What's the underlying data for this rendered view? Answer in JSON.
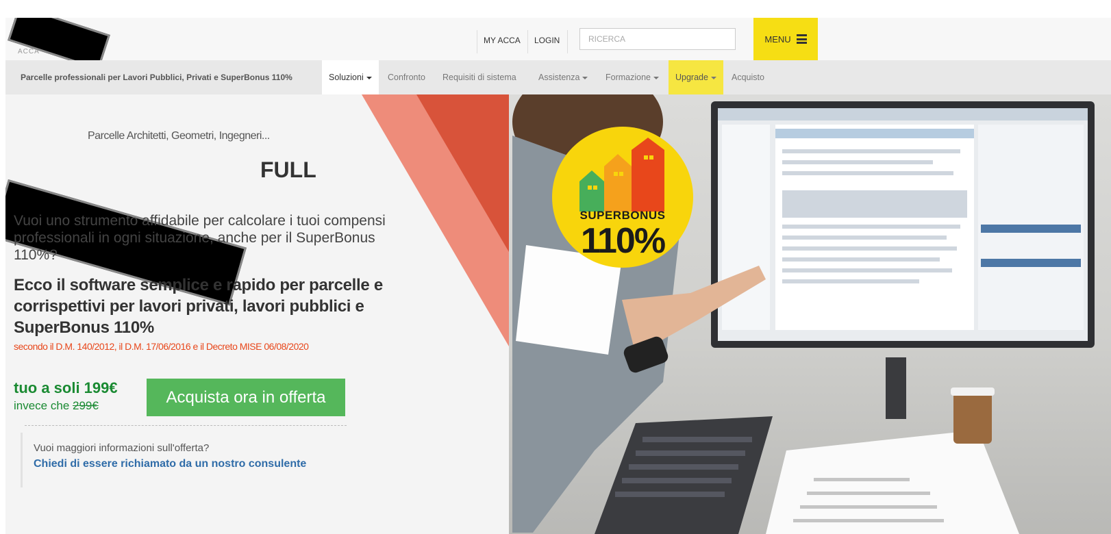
{
  "header": {
    "logo_text": "ACCA",
    "links": [
      "MY ACCA",
      "LOGIN"
    ],
    "search_placeholder": "RICERCA",
    "menu_label": "MENU"
  },
  "nav": {
    "brand": "Parcelle professionali per Lavori Pubblici, Privati e SuperBonus 110%",
    "items": [
      {
        "label": "Soluzioni",
        "dropdown": true
      },
      {
        "label": "Confronto",
        "dropdown": false
      },
      {
        "label": "Requisiti di sistema",
        "dropdown": false
      },
      {
        "label": "Assistenza",
        "dropdown": true
      },
      {
        "label": "Formazione",
        "dropdown": true
      },
      {
        "label": "Upgrade",
        "dropdown": true
      },
      {
        "label": "Acquisto",
        "dropdown": false
      }
    ]
  },
  "hero": {
    "subtitle_partial": "Parcelle Architetti, Geometri, Ingegneri...",
    "product_suffix": "FULL",
    "intro": "Vuoi uno strumento affidabile per calcolare i tuoi compensi professionali in ogni situazione, anche per il SuperBonus 110%?",
    "headline": "Ecco il software semplice e rapido per parcelle e corrispettivi per lavori privati, lavori pubblici e SuperBonus 110%",
    "decree": "secondo il D.M. 140/2012, il D.M. 17/06/2016 e il Decreto MISE 06/08/2020",
    "price_text": "tuo a soli 199€",
    "old_price_prefix": "invece che",
    "old_price": "299€",
    "buy_button": "Acquista ora in offerta",
    "info_question": "Vuoi maggiori informazioni sull'offerta?",
    "info_link": "Chiedi di essere richiamato da un nostro consulente",
    "badge_line1": "SUPERBONUS",
    "badge_line2": "110%"
  },
  "colors": {
    "menu_yellow": "#f6de14",
    "upgrade_yellow": "#f6e641",
    "price_green": "#1a8a32",
    "button_green": "#55b75b",
    "decree_red": "#e8471b",
    "link_blue": "#2f6ca8",
    "badge_yellow": "#f8d50c"
  },
  "icons": {
    "menu": "hamburger-icon",
    "dropdown": "caret-down-icon"
  }
}
